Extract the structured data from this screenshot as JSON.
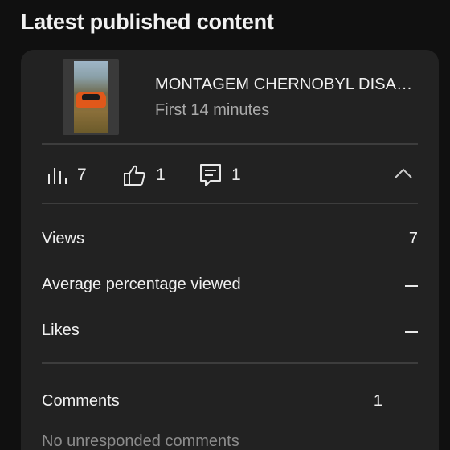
{
  "section": {
    "title": "Latest published content"
  },
  "video": {
    "title": "MONTAGEM CHERNOBYL DISA…",
    "subtitle": "First 14 minutes"
  },
  "stats": {
    "views": "7",
    "likes": "1",
    "comments": "1"
  },
  "metrics": [
    {
      "label": "Views",
      "value": "7"
    },
    {
      "label": "Average percentage viewed",
      "value": ""
    },
    {
      "label": "Likes",
      "value": ""
    }
  ],
  "comments": {
    "label": "Comments",
    "value": "1",
    "status": "No unresponded comments"
  }
}
